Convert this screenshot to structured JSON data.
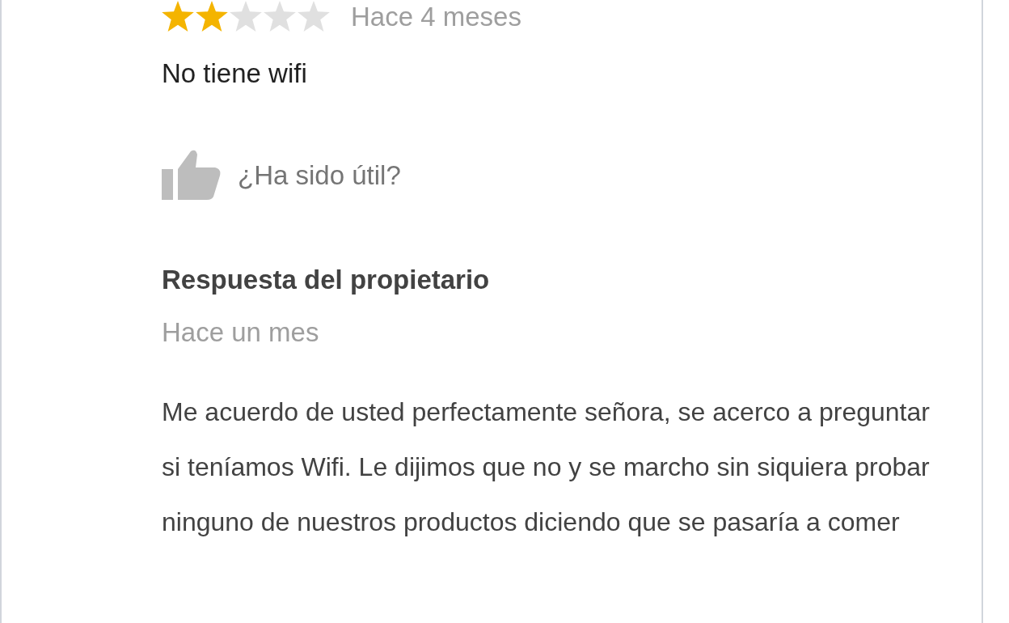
{
  "review": {
    "stars": 2,
    "time": "Hace 4 meses",
    "text": "No tiene wifi",
    "helpful": "¿Ha sido útil?"
  },
  "owner_reply": {
    "title": "Respuesta del propietario",
    "time": "Hace un mes",
    "text": "Me acuerdo de usted perfectamente señora, se acerco a preguntar si teníamos Wifi. Le dijimos que no y se marcho sin siquiera probar ninguno de nuestros productos diciendo que se pasaría a comer"
  }
}
